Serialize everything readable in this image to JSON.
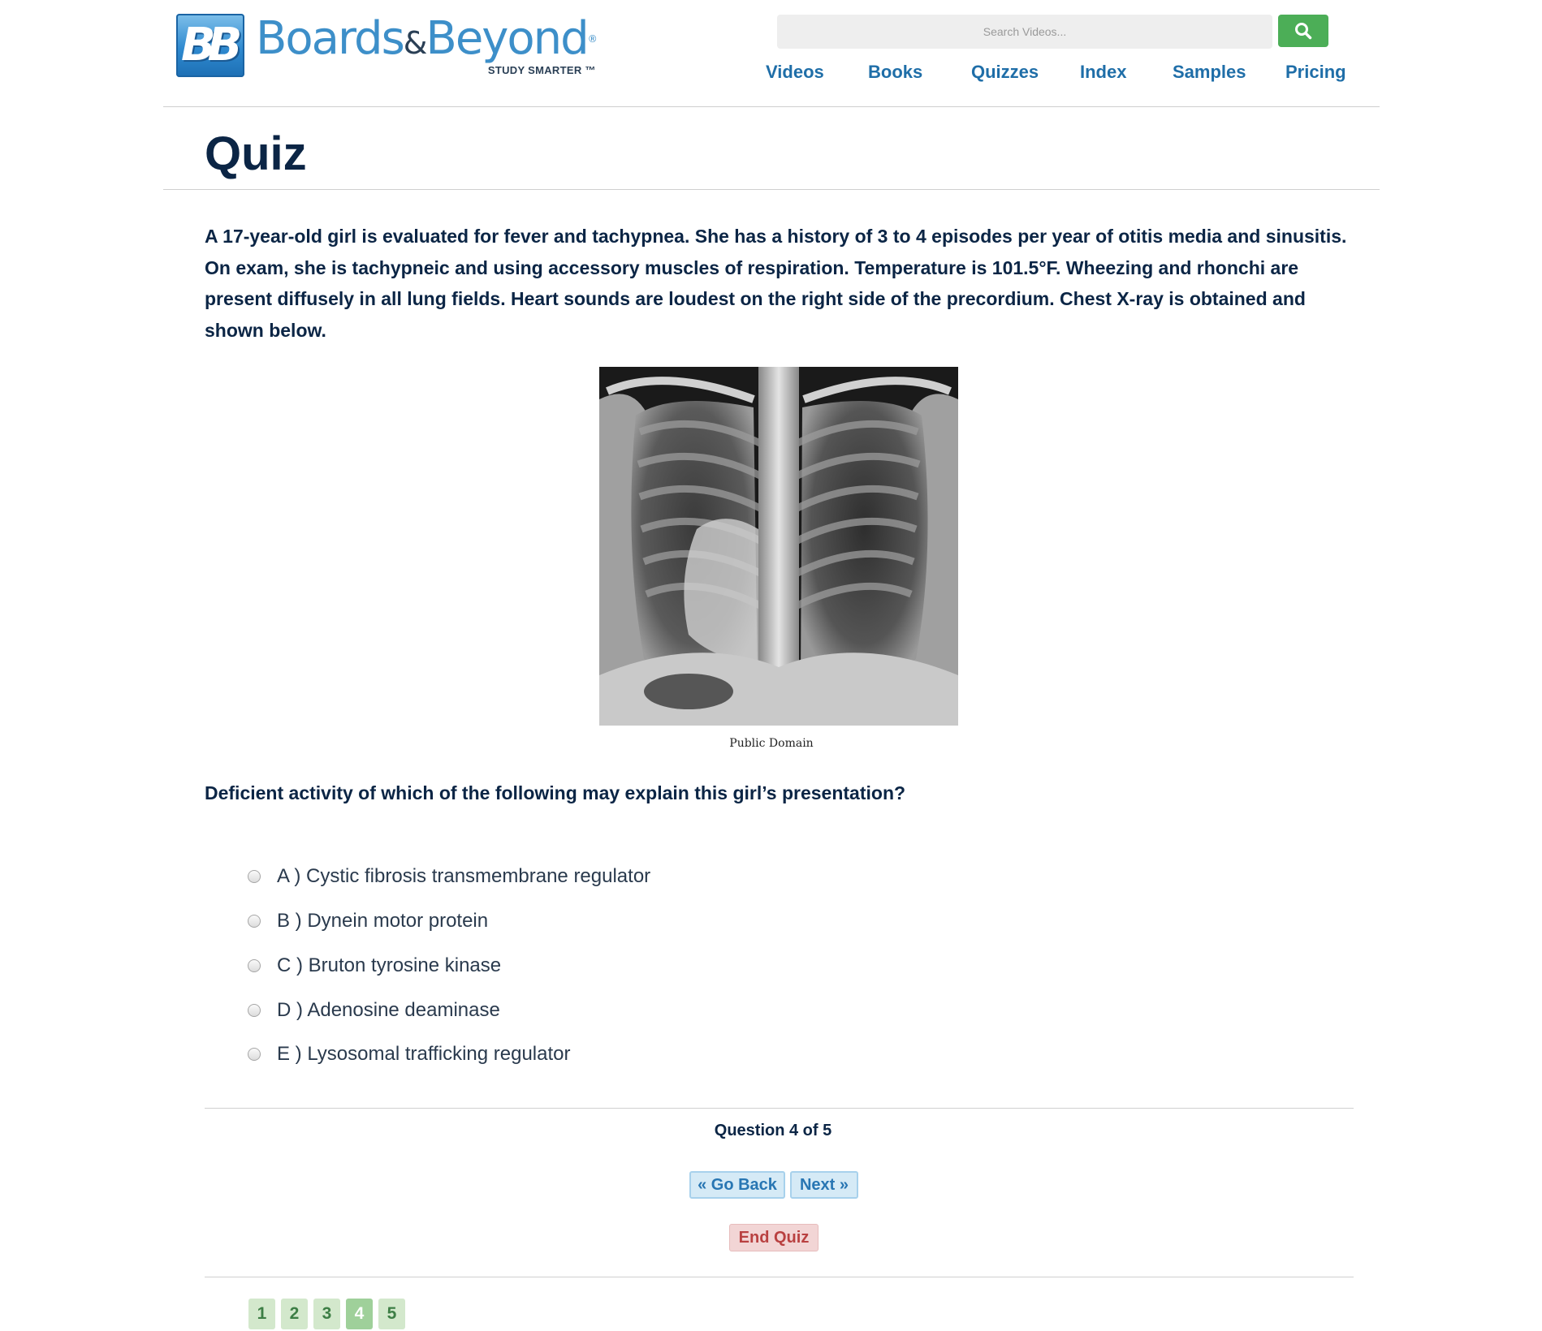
{
  "brand": {
    "name_part1": "Boards",
    "name_amp": "&",
    "name_part2": "Beyond",
    "registered": "®",
    "tagline": "STUDY SMARTER ™",
    "mark": "BB"
  },
  "search": {
    "placeholder": "Search Videos...",
    "icon": "search-icon"
  },
  "nav": [
    {
      "label": "Videos"
    },
    {
      "label": "Books"
    },
    {
      "label": "Quizzes"
    },
    {
      "label": "Index"
    },
    {
      "label": "Samples"
    },
    {
      "label": "Pricing"
    }
  ],
  "page": {
    "title": "Quiz"
  },
  "question": {
    "stem": "A 17-year-old girl is evaluated for fever and tachypnea. She has a history of 3 to 4 episodes per year of otitis media and sinusitis.  On exam, she is tachypneic and using accessory muscles of respiration. Temperature is 101.5°F. Wheezing and rhonchi are present diffusely in all lung fields. Heart sounds are loudest on the right side of the precordium. Chest X-ray is obtained and shown below.",
    "image_caption": "Public Domain",
    "prompt": "Deficient activity of which of the following may explain this girl’s presentation?",
    "options": [
      {
        "label": "A ) Cystic fibrosis transmembrane regulator"
      },
      {
        "label": "B ) Dynein motor protein"
      },
      {
        "label": "C ) Bruton tyrosine kinase"
      },
      {
        "label": "D ) Adenosine deaminase"
      },
      {
        "label": "E ) Lysosomal trafficking regulator"
      }
    ]
  },
  "progress": {
    "counter": "Question 4 of 5",
    "current": 4,
    "total": 5
  },
  "controls": {
    "back_label": "« Go Back",
    "next_label": "Next »",
    "end_label": "End Quiz"
  },
  "pages": [
    "1",
    "2",
    "3",
    "4",
    "5"
  ],
  "colors": {
    "brand_blue": "#3d8fc9",
    "nav_blue": "#1f6ea8",
    "search_green": "#4cae57",
    "title_navy": "#0b2545",
    "end_red": "#b94141"
  }
}
